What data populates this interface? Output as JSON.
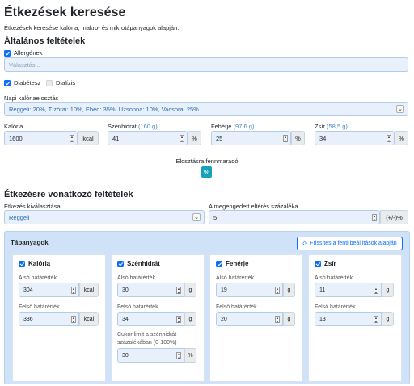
{
  "header": {
    "title": "Étkezések keresése",
    "subtitle": "Étkezések keresése kalória, makro- és mikrotápanyagok alapján."
  },
  "general": {
    "heading": "Általános feltételek",
    "allergens_label": "Allergének",
    "allergens_placeholder": "Választás...",
    "diabetes_label": "Diabétesz",
    "dialysis_label": "Dialízis",
    "distribution_label": "Napi kalóriaelosztás",
    "distribution_value": "Reggeli: 20%, Tízórai: 10%, Ebéd: 35%, Uzsonna: 10%, Vacsora: 25%",
    "calories_label": "Kalória",
    "calories_value": "1600",
    "calories_unit": "kcal",
    "carbs_label": "Szénhidrát",
    "carbs_hint": "(160 g)",
    "carbs_value": "41",
    "fat_label": "Fehérje",
    "fat_hint": "(97,6 g)",
    "fat_value": "25",
    "zsir_label": "Zsír",
    "zsir_hint": "(58,5 g)",
    "zsir_value": "34",
    "pct_unit": "%",
    "remaining_label": "Elosztásra fennmaradó",
    "remaining_button": "%"
  },
  "meal": {
    "heading": "Étkezésre vonatkozó feltételek",
    "select_label": "Étkezés kiválasztása",
    "select_value": "Reggeli",
    "deviation_label": "A megengedett eltérés százaléka.",
    "deviation_value": "5",
    "deviation_unit": "(+/-)%"
  },
  "nutrients": {
    "title": "Tápanyagok",
    "refresh_label": "Frissítés a fenti beállítások alapján",
    "cards": [
      {
        "name": "Kalória",
        "lower_label": "Alsó határérték",
        "lower": "304",
        "upper_label": "Felső határérték",
        "upper": "336",
        "unit": "kcal"
      },
      {
        "name": "Szénhidrát",
        "lower_label": "Alsó határérték",
        "lower": "30",
        "upper_label": "Felső határérték",
        "upper": "34",
        "unit": "g",
        "extra_label_1": "Cukor limit a szénhidrát",
        "extra_label_2": "százalékában (0-100%)",
        "extra_value": "30",
        "extra_unit": "%"
      },
      {
        "name": "Fehérje",
        "lower_label": "Alsó határérték",
        "lower": "19",
        "upper_label": "Felső határérték",
        "upper": "20",
        "unit": "g"
      },
      {
        "name": "Zsír",
        "lower_label": "Alsó határérték",
        "lower": "11",
        "upper_label": "Felső határérték",
        "upper": "13",
        "unit": "g"
      }
    ]
  },
  "colors": {
    "accent": "#0d6efd",
    "info": "#17a2b8",
    "panel": "#cfe2f8"
  }
}
